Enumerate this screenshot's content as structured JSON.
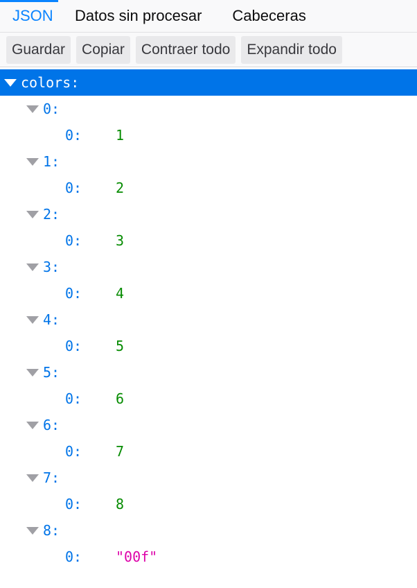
{
  "tabs": [
    {
      "label": "JSON",
      "selected": true
    },
    {
      "label": "Datos sin procesar",
      "selected": false
    },
    {
      "label": "Cabeceras",
      "selected": false
    }
  ],
  "toolbar": {
    "save": "Guardar",
    "copy": "Copiar",
    "collapse_all": "Contraer todo",
    "expand_all": "Expandir todo"
  },
  "tree": {
    "root_key": "colors:",
    "items": [
      {
        "index_key": "0:",
        "child_key": "0:",
        "value": "1"
      },
      {
        "index_key": "1:",
        "child_key": "0:",
        "value": "2"
      },
      {
        "index_key": "2:",
        "child_key": "0:",
        "value": "3"
      },
      {
        "index_key": "3:",
        "child_key": "0:",
        "value": "4"
      },
      {
        "index_key": "4:",
        "child_key": "0:",
        "value": "5"
      },
      {
        "index_key": "5:",
        "child_key": "0:",
        "value": "6"
      },
      {
        "index_key": "6:",
        "child_key": "0:",
        "value": "7"
      },
      {
        "index_key": "7:",
        "child_key": "0:",
        "value": "8"
      },
      {
        "index_key": "8:",
        "child_key": "0:",
        "value": "\"00f\""
      }
    ]
  },
  "colors": {
    "accent": "#0a84ff",
    "selected_row": "#0074e8",
    "key": "#0074e8",
    "number": "#058b00",
    "string": "#dd00a9"
  },
  "icons": {
    "expanded": "triangle-down-icon"
  }
}
